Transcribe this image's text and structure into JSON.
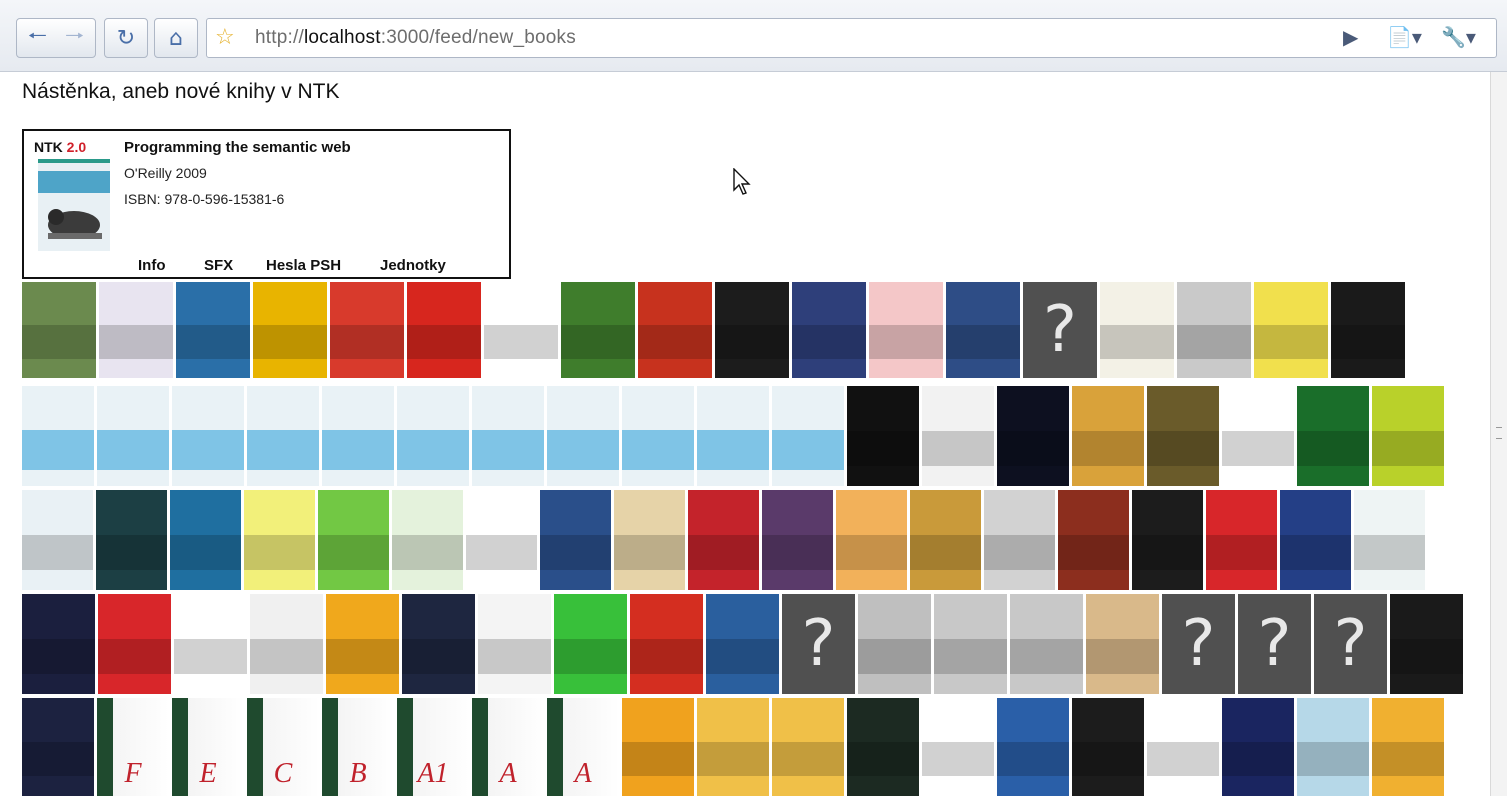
{
  "browser": {
    "url_prefix": "http://",
    "url_host": "localhost",
    "url_rest": ":3000/feed/new_books",
    "back_icon": "back-arrow-icon",
    "forward_icon": "forward-arrow-icon",
    "reload_icon": "reload-icon",
    "home_icon": "home-icon",
    "bookmark_icon": "star-icon"
  },
  "page": {
    "title": "Nástěnka, aneb nové knihy v NTK"
  },
  "detail": {
    "logo_text": "NTK",
    "logo_version": "2.0",
    "book_title": "Programming the semantic web",
    "publisher": "O'Reilly 2009",
    "isbn": "ISBN: 978-0-596-15381-6",
    "links": [
      "Info",
      "SFX",
      "Hesla PSH",
      "Jednotky"
    ]
  },
  "shelf": {
    "question_mark": "?",
    "rows": [
      [
        "#6b8a4e",
        "#e8e4f0",
        "#2a6fa8",
        "#e8b400",
        "#d83a2c",
        "#d7261e",
        "#ffffff",
        "#3f7d2c",
        "#c7321e",
        "#1c1c1c",
        "#2e3f7a",
        "#f4c7c8",
        "#2e4d86",
        "?",
        "#f3f1e6",
        "#c9c9c9",
        "#f1e04d",
        "#1a1a1a"
      ],
      [
        "#e9f2f6",
        "#e9f2f6",
        "#e9f2f6",
        "#e9f2f6",
        "#e9f2f6",
        "#e9f2f6",
        "#e9f2f6",
        "#e9f2f6",
        "#e9f2f6",
        "#e9f2f6",
        "#e9f2f6",
        "#111111",
        "#f2f2f2",
        "#0d1020",
        "#d9a23a",
        "#6a5b2a",
        "#ffffff",
        "#1a6e2a",
        "#b9d12a"
      ],
      [
        "#e9f1f5",
        "#1c3f44",
        "#1f6fa0",
        "#f2f07a",
        "#72c844",
        "#e4f2dc",
        "#ffffff",
        "#2a4f8a",
        "#e6d3a8",
        "#c4232b",
        "#5a3a6a",
        "#f2b15a",
        "#c99a3a",
        "#d2d2d2",
        "#8c2e1e",
        "#1c1c1c",
        "#d8262a",
        "#243f86",
        "#eef4f4"
      ],
      [
        "#1b1f3e",
        "#d8262a",
        "#ffffff",
        "#f0f0f0",
        "#f0a81c",
        "#1e2640",
        "#f4f4f4",
        "#38c03a",
        "#d42e20",
        "#2a5f9e",
        "?",
        "#bfbfbf",
        "#c8c8c8",
        "#c8c8c8",
        "#d9b98a",
        "?",
        "?",
        "?",
        "#1a1a1a"
      ],
      [
        "#1c2240",
        "F",
        "E",
        "C",
        "B",
        "A1",
        "A",
        "A",
        "#f0a21e",
        "#f0c048",
        "#f0c048",
        "#1c2a22",
        "#ffffff",
        "#2a5fa8",
        "#1c1c1c",
        "#ffffff",
        "#1a2560",
        "#b6d8e8",
        "#f0b030"
      ]
    ]
  }
}
